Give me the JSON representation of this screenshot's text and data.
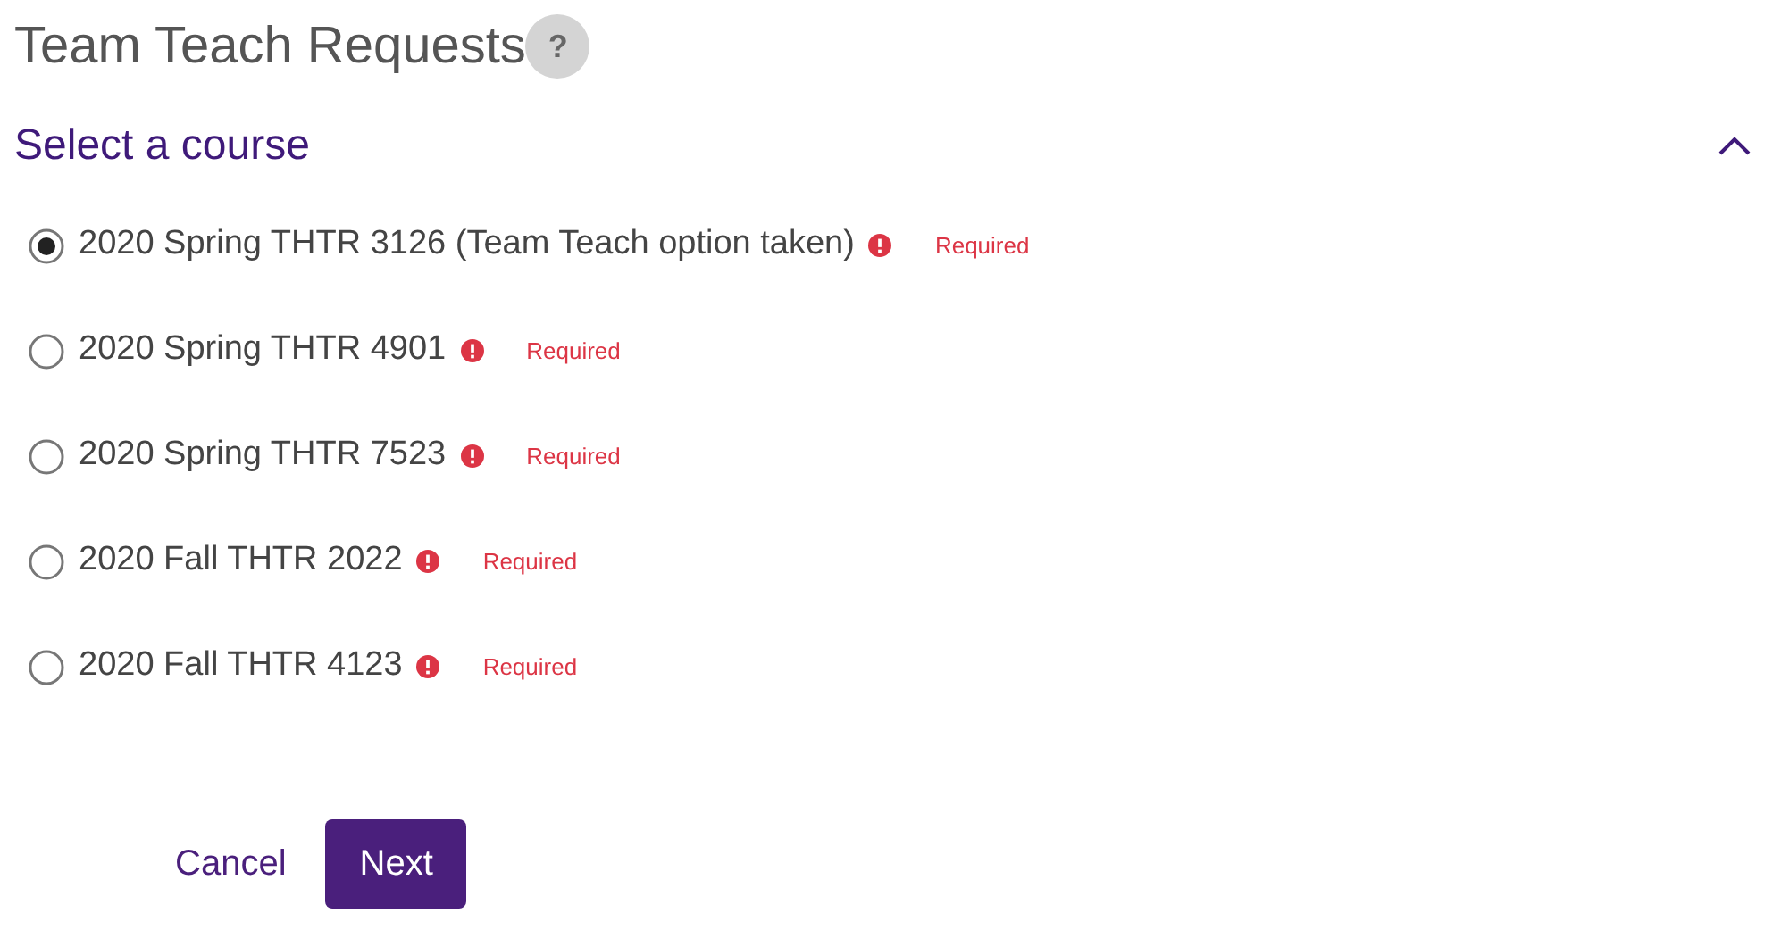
{
  "page": {
    "title": "Team Teach Requests",
    "help": "?"
  },
  "section": {
    "title": "Select a course",
    "expanded": true
  },
  "courses": [
    {
      "label": "2020 Spring THTR 3126 (Team Teach option taken)",
      "selected": true,
      "error": "Required"
    },
    {
      "label": "2020 Spring THTR 4901",
      "selected": false,
      "error": "Required"
    },
    {
      "label": "2020 Spring THTR 7523",
      "selected": false,
      "error": "Required"
    },
    {
      "label": "2020 Fall THTR 2022",
      "selected": false,
      "error": "Required"
    },
    {
      "label": "2020 Fall THTR 4123",
      "selected": false,
      "error": "Required"
    }
  ],
  "buttons": {
    "cancel": "Cancel",
    "next": "Next"
  }
}
